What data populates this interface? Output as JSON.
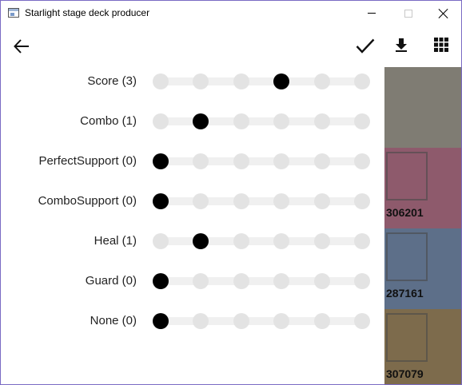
{
  "window": {
    "title": "Starlight stage deck producer"
  },
  "toolbar": {
    "back_icon": "arrow-left-icon",
    "confirm_icon": "checkmark-icon"
  },
  "background": {
    "download_icon": "download-icon",
    "grid_icon": "grid-icon",
    "cards": [
      {
        "number": "",
        "color": "#7f7c73"
      },
      {
        "number": "306201",
        "color": "#8e5a6c"
      },
      {
        "number": "287161",
        "color": "#5d6f89"
      },
      {
        "number": "307079",
        "color": "#7d6b4c"
      }
    ]
  },
  "filters": {
    "steps": 6,
    "rows": [
      {
        "label": "Score (3)",
        "value": 3
      },
      {
        "label": "Combo (1)",
        "value": 1
      },
      {
        "label": "PerfectSupport (0)",
        "value": 0
      },
      {
        "label": "ComboSupport (0)",
        "value": 0
      },
      {
        "label": "Heal (1)",
        "value": 1
      },
      {
        "label": "Guard (0)",
        "value": 0
      },
      {
        "label": "None (0)",
        "value": 0
      }
    ]
  },
  "colors": {
    "active_dot": "#000000",
    "inactive_dot": "#e3e3e3",
    "track": "#f0f0f0"
  }
}
